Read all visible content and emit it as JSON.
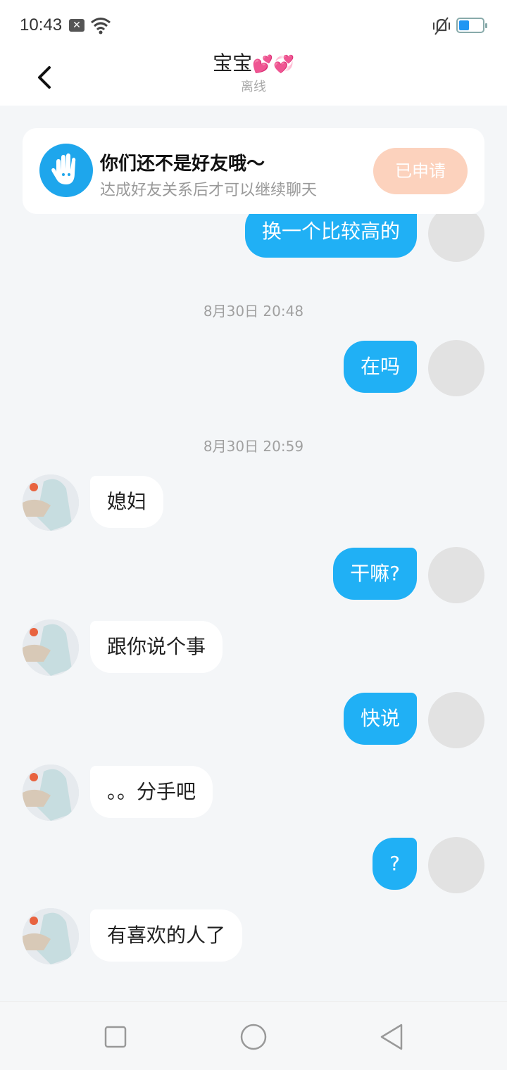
{
  "status": {
    "time": "10:43"
  },
  "header": {
    "title": "宝宝",
    "hearts": "💕💞",
    "subtitle": "离线"
  },
  "friend_notice": {
    "title": "你们还不是好友哦～",
    "subtitle": "达成好友关系后才可以继续聊天",
    "button": "已申请"
  },
  "messages": {
    "partial_top": "换一个比较高的",
    "ts1": "8月30日 20:48",
    "m1": "在吗",
    "ts2": "8月30日 20:59",
    "m2": "媳妇",
    "m3": "干嘛?",
    "m4": "跟你说个事",
    "m5": "快说",
    "m6": "。。分手吧",
    "m7": "?",
    "m8": "有喜欢的人了"
  },
  "colors": {
    "accent": "#20b0f5",
    "applied_button": "#fcd2bd"
  }
}
